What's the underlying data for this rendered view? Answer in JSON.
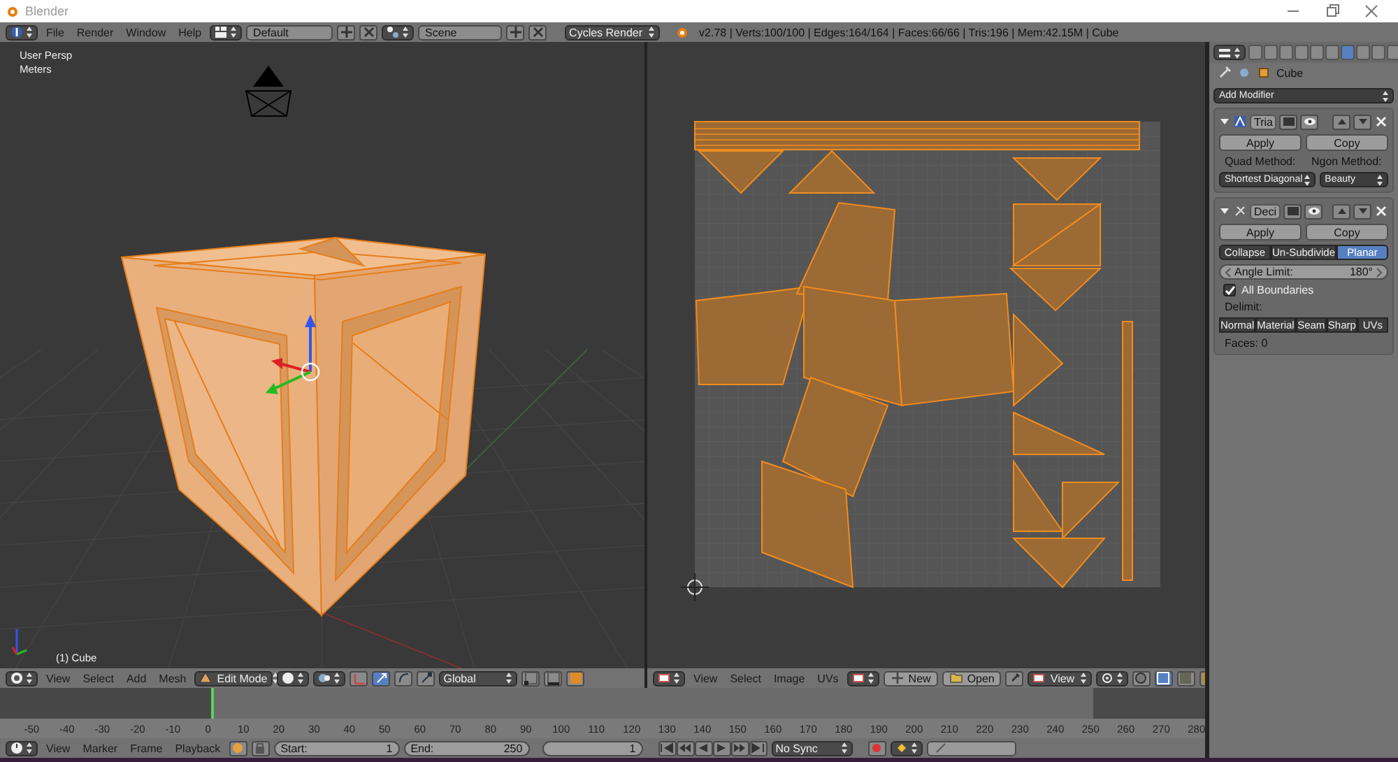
{
  "window": {
    "title": "Blender"
  },
  "info_header": {
    "menus": [
      "File",
      "Render",
      "Window",
      "Help"
    ],
    "layout": "Default",
    "scene": "Scene",
    "engine": "Cycles Render",
    "stats": "v2.78 | Verts:100/100 | Edges:164/164 | Faces:66/66 | Tris:196 | Mem:42.15M | Cube"
  },
  "viewport": {
    "view_name": "User Persp",
    "units": "Meters",
    "object_label": "(1) Cube",
    "header": {
      "menus": [
        "View",
        "Select",
        "Add",
        "Mesh"
      ],
      "mode": "Edit Mode",
      "orientation": "Global"
    }
  },
  "uv_editor": {
    "header": {
      "menus": [
        "View",
        "Select",
        "Image",
        "UVs"
      ],
      "new": "New",
      "open": "Open",
      "view": "View"
    }
  },
  "properties": {
    "tabs": [
      {
        "selected": false
      },
      {
        "selected": false
      },
      {
        "selected": false
      },
      {
        "selected": false
      },
      {
        "selected": false
      },
      {
        "selected": false
      },
      {
        "selected": true
      },
      {
        "selected": false
      },
      {
        "selected": false
      },
      {
        "selected": false
      }
    ],
    "object": "Cube",
    "add_modifier": "Add Modifier",
    "modifiers": [
      {
        "kind": "triangulate",
        "name": "Tria",
        "apply": "Apply",
        "copy": "Copy",
        "quad_label": "Quad Method:",
        "ngon_label": "Ngon Method:",
        "quad_value": "Shortest Diagonal",
        "ngon_value": "Beauty"
      },
      {
        "kind": "decimate",
        "name": "Deci",
        "apply": "Apply",
        "copy": "Copy",
        "modes": [
          {
            "label": "Collapse",
            "selected": false
          },
          {
            "label": "Un-Subdivide",
            "selected": false
          },
          {
            "label": "Planar",
            "selected": true
          }
        ],
        "angle_label": "Angle Limit:",
        "angle_value": "180°",
        "all_boundaries": {
          "label": "All Boundaries",
          "checked": true
        },
        "delimit_label": "Delimit:",
        "delimit": [
          {
            "label": "Normal",
            "selected": false
          },
          {
            "label": "Material",
            "selected": false
          },
          {
            "label": "Seam",
            "selected": false
          },
          {
            "label": "Sharp",
            "selected": false
          },
          {
            "label": "UVs",
            "selected": false
          }
        ],
        "faces": "Faces: 0"
      }
    ]
  },
  "timeline": {
    "ticks": [
      "-50",
      "-40",
      "-30",
      "-20",
      "-10",
      "0",
      "10",
      "20",
      "30",
      "40",
      "50",
      "60",
      "70",
      "80",
      "90",
      "100",
      "110",
      "120",
      "130",
      "140",
      "150",
      "160",
      "170",
      "180",
      "190",
      "200",
      "210",
      "220",
      "230",
      "240",
      "250",
      "260",
      "270",
      "280"
    ],
    "header": {
      "menus": [
        "View",
        "Marker",
        "Frame",
        "Playback"
      ],
      "start_label": "Start:",
      "start": "1",
      "end_label": "End:",
      "end": "250",
      "current": "1",
      "sync": "No Sync"
    }
  }
}
